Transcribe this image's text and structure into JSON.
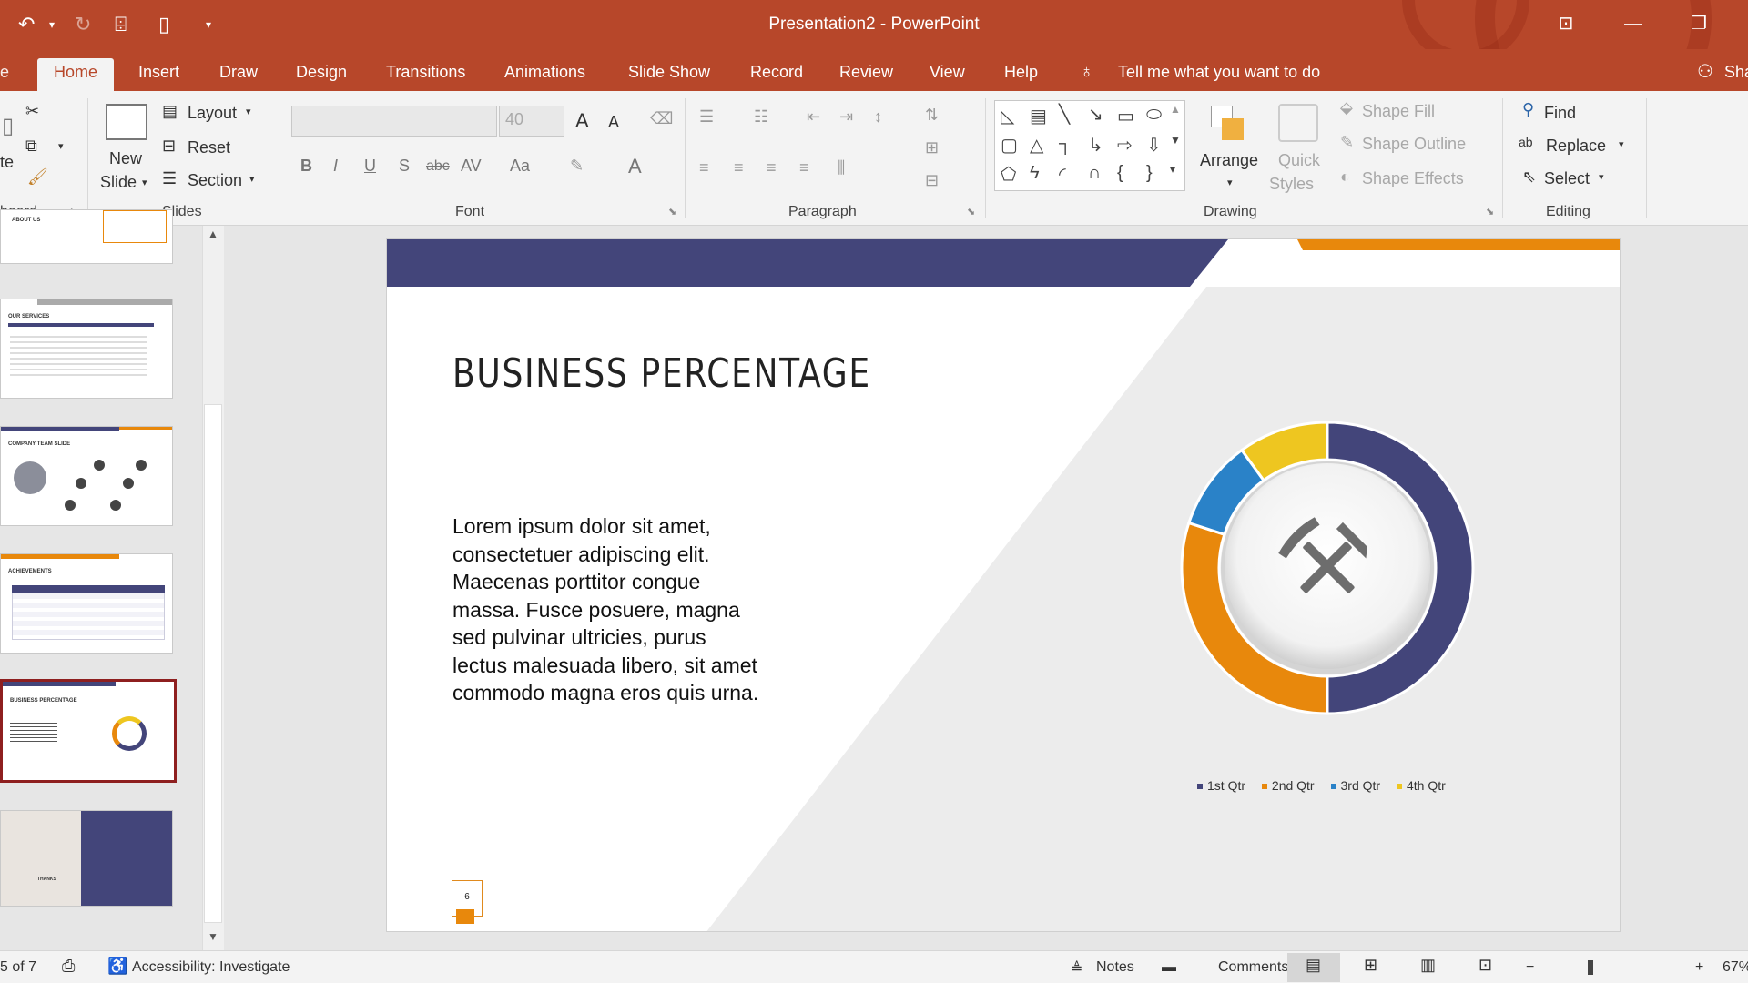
{
  "window": {
    "title": "Presentation2  -  PowerPoint",
    "accent_color": "#b7472a"
  },
  "quick_access": {
    "undo_icon": "undo-icon",
    "redo_icon": "redo-icon",
    "present_icon": "present-icon",
    "new_icon": "new-file-icon"
  },
  "tabs": [
    "Home",
    "Insert",
    "Draw",
    "Design",
    "Transitions",
    "Animations",
    "Slide Show",
    "Record",
    "Review",
    "View",
    "Help"
  ],
  "tell_me": "Tell me what you want to do",
  "share_label": "Sha",
  "ribbon": {
    "clipboard": {
      "label": "board",
      "paste": "te"
    },
    "slides": {
      "label": "Slides",
      "new_slide_line1": "New",
      "new_slide_line2": "Slide",
      "layout": "Layout",
      "reset": "Reset",
      "section": "Section"
    },
    "font": {
      "label": "Font",
      "font_name": "",
      "font_size": "40",
      "bold": "B",
      "italic": "I",
      "underline": "U",
      "shadow": "S",
      "strike": "abc",
      "spacing": "AV",
      "case": "Aa",
      "grow": "A",
      "shrink": "A",
      "color": "A"
    },
    "paragraph": {
      "label": "Paragraph"
    },
    "drawing": {
      "label": "Drawing",
      "arrange": "Arrange",
      "quick_styles_1": "Quick",
      "quick_styles_2": "Styles",
      "shape_fill": "Shape Fill",
      "shape_outline": "Shape Outline",
      "shape_effects": "Shape Effects"
    },
    "editing": {
      "label": "Editing",
      "find": "Find",
      "replace": "Replace",
      "select": "Select"
    }
  },
  "thumbnails": [
    {
      "title": "ABOUT US"
    },
    {
      "title": "OUR SERVICES"
    },
    {
      "title": "COMPANY TEAM SLIDE"
    },
    {
      "title": "ACHIEVEMENTS"
    },
    {
      "title": "BUSINESS PERCENTAGE"
    },
    {
      "title": "THANKS"
    }
  ],
  "slide": {
    "title": "BUSINESS PERCENTAGE",
    "body": "Lorem ipsum dolor sit amet, consectetuer adipiscing elit. Maecenas porttitor congue massa. Fusce posuere, magna sed pulvinar ultricies, purus lectus malesuada libero, sit amet commodo magna eros quis urna.",
    "number": "6",
    "colors": {
      "navy": "#43457a",
      "orange": "#e8880c",
      "blue": "#2a82c8",
      "yellow": "#eec620"
    },
    "center_icon": "hammer-pick-icon"
  },
  "chart_data": {
    "type": "pie",
    "categories": [
      "1st Qtr",
      "2nd Qtr",
      "3rd Qtr",
      "4th Qtr"
    ],
    "values": [
      50,
      30,
      10,
      10
    ],
    "colors": [
      "#43457a",
      "#e8880c",
      "#2a82c8",
      "#eec620"
    ],
    "legend_position": "bottom"
  },
  "statusbar": {
    "slide_of": "5 of 7",
    "accessibility": "Accessibility: Investigate",
    "notes": "Notes",
    "comments": "Comments",
    "zoom": "67%"
  }
}
